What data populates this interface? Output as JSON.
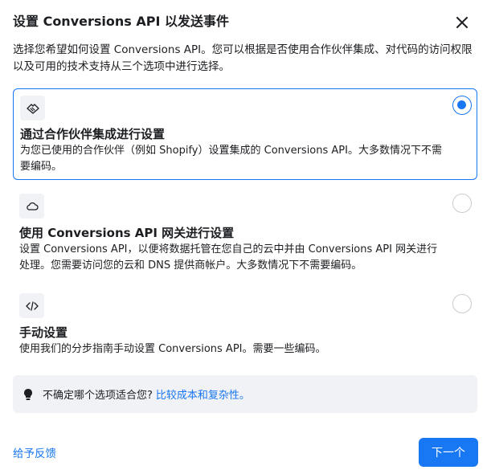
{
  "dialog": {
    "title": "设置 Conversions API 以发送事件",
    "intro": "选择您希望如何设置 Conversions API。您可以根据是否使用合作伙伴集成、对代码的访问权限以及可用的技术支持从三个选项中进行选择。"
  },
  "options": [
    {
      "icon": "handshake-icon",
      "title": "通过合作伙伴集成进行设置",
      "desc": "为您已使用的合作伙伴（例如 Shopify）设置集成的 Conversions API。大多数情况下不需要编码。",
      "selected": true
    },
    {
      "icon": "cloud-icon",
      "title": "使用 Conversions API 网关进行设置",
      "desc": "设置 Conversions API，以便将数据托管在您自己的云中并由 Conversions API 网关进行处理。您需要访问您的云和 DNS 提供商帐户。大多数情况下不需要编码。",
      "selected": false
    },
    {
      "icon": "code-icon",
      "title": "手动设置",
      "desc": "使用我们的分步指南手动设置 Conversions API。需要一些编码。",
      "selected": false
    }
  ],
  "tip": {
    "text": "不确定哪个选项适合您?",
    "link": "比较成本和复杂性。"
  },
  "footer": {
    "feedback": "给予反馈",
    "next": "下一个"
  },
  "colors": {
    "accent": "#1877f2",
    "tip_bg": "#f0f2f5"
  }
}
